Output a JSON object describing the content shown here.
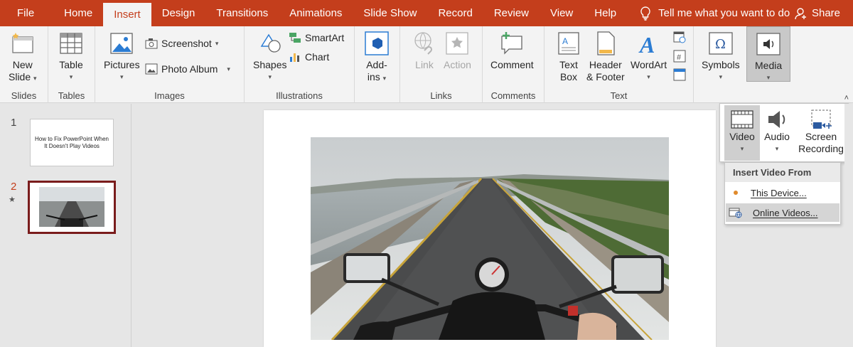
{
  "tabs": [
    "File",
    "Home",
    "Insert",
    "Design",
    "Transitions",
    "Animations",
    "Slide Show",
    "Record",
    "Review",
    "View",
    "Help"
  ],
  "active_tab": "Insert",
  "tell_me": "Tell me what you want to do",
  "share": "Share",
  "ribbon": {
    "slides": {
      "new_slide": "New",
      "new_slide2": "Slide",
      "label": "Slides"
    },
    "tables": {
      "table": "Table",
      "label": "Tables"
    },
    "images": {
      "pictures": "Pictures",
      "screenshot": "Screenshot",
      "photo_album": "Photo Album",
      "label": "Images"
    },
    "illustrations": {
      "shapes": "Shapes",
      "smartart": "SmartArt",
      "chart": "Chart",
      "label": "Illustrations"
    },
    "addins": {
      "addins": "Add-",
      "addins2": "ins"
    },
    "links": {
      "link": "Link",
      "action": "Action",
      "label": "Links"
    },
    "comments": {
      "comment": "Comment",
      "label": "Comments"
    },
    "text": {
      "textbox": "Text",
      "textbox2": "Box",
      "header": "Header",
      "header2": "& Footer",
      "wordart": "WordArt",
      "label": "Text"
    },
    "symbols": {
      "symbols": "Symbols"
    },
    "media": {
      "media": "Media"
    }
  },
  "slides": [
    {
      "number": "1",
      "title": "How to Fix PowerPoint When It Doesn't Play Videos"
    },
    {
      "number": "2",
      "marker": "★"
    }
  ],
  "media_menu": {
    "video": "Video",
    "audio": "Audio",
    "screen": "Screen",
    "recording": "Recording",
    "submenu_title": "Insert Video From",
    "this_device": "This Device...",
    "online_videos": "Online Videos..."
  },
  "colors": {
    "accent": "#c43e1c",
    "selected_slide_border": "#7a1c1c"
  }
}
